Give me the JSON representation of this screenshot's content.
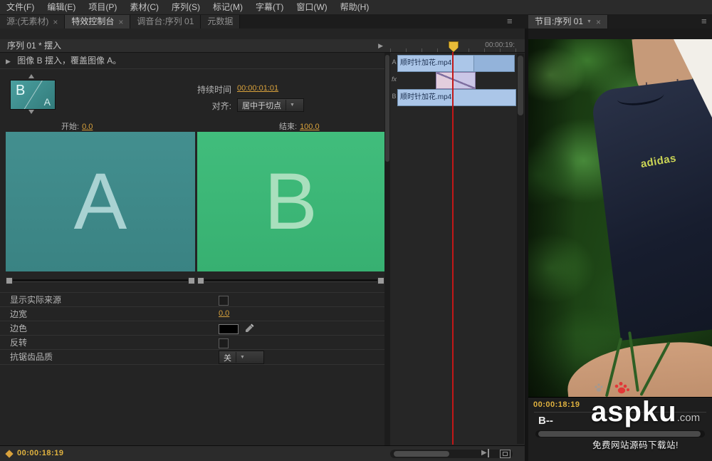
{
  "menu": {
    "items": [
      "文件(F)",
      "编辑(E)",
      "项目(P)",
      "素材(C)",
      "序列(S)",
      "标记(M)",
      "字幕(T)",
      "窗口(W)",
      "帮助(H)"
    ]
  },
  "panel_tabs": {
    "source": "源:(无素材)",
    "effects": "特效控制台",
    "mixer": "调音台:序列 01",
    "metadata": "元数据",
    "program": "节目:序列 01"
  },
  "icons": {
    "close": "×",
    "panel_menu": "≡",
    "caret_down": "▼",
    "twirl": "▶",
    "play": "▶"
  },
  "effect_panel": {
    "header": "序列 01 * 摆入",
    "description": "图像 B 摆入，覆盖图像 A。",
    "thumb_b": "B",
    "thumb_a": "A",
    "duration_label": "持续时间",
    "duration_value": "00:00:01:01",
    "align_label": "对齐:",
    "align_value": "居中于切点",
    "start_label": "开始:",
    "start_value": "0.0",
    "end_label": "结束:",
    "end_value": "100.0",
    "preview_a_letter": "A",
    "preview_b_letter": "B",
    "rows": {
      "show_source_label": "显示实际来源",
      "show_source_checked": false,
      "border_width_label": "边宽",
      "border_width_value": "0.0",
      "border_color_label": "边色",
      "reverse_label": "反转",
      "reverse_checked": false,
      "antialias_label": "抗锯齿品质",
      "antialias_value": "关"
    },
    "status_timecode": "00:00:18:19"
  },
  "timeline": {
    "ruler_timecode": "00:00:19:",
    "tracks": [
      {
        "label": "A",
        "clip": "顺时针加花.mp4"
      },
      {
        "label": "fx",
        "clip": ""
      },
      {
        "label": "B",
        "clip": "顺时针加花.mp4"
      }
    ]
  },
  "program": {
    "timecode": "00:00:18:19",
    "marker_label": "B--",
    "shirt_text": "adidas"
  },
  "watermark": {
    "brand": "aspku",
    "suffix": ".com",
    "tagline": "免费网站源码下载站!"
  },
  "colors": {
    "accent_orange": "#d9a23c",
    "preview_a_teal": "#3f8c8c",
    "preview_b_green": "#3cb878",
    "clip_blue": "#abc6e8",
    "playhead_red": "#c21717",
    "marker_yellow": "#e8bb38",
    "watermark_red": "#e23737"
  }
}
